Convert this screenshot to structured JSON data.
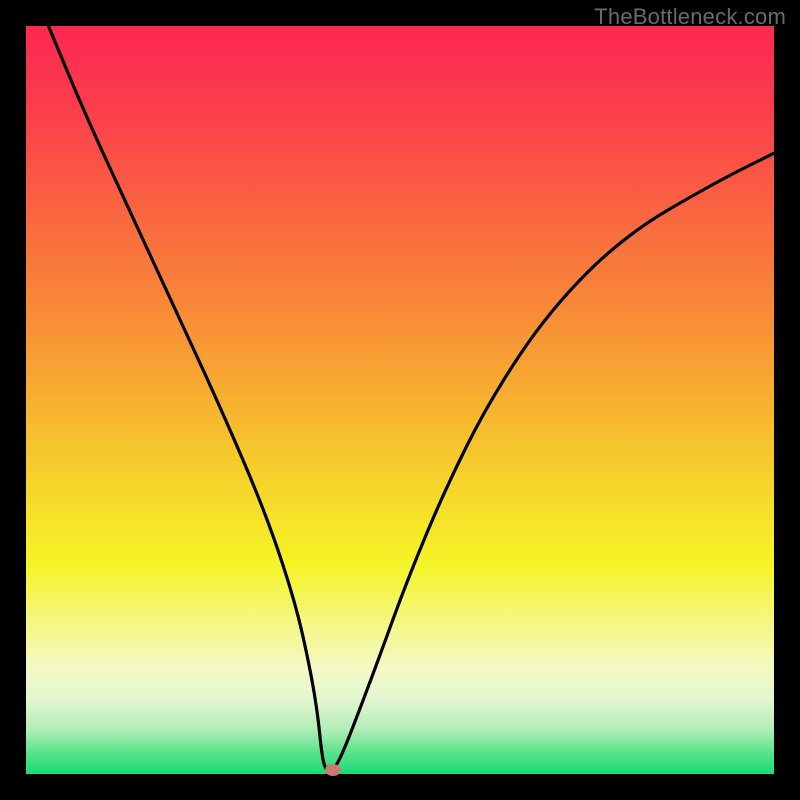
{
  "watermark": "TheBottleneck.com",
  "chart_data": {
    "type": "line",
    "title": "",
    "xlabel": "",
    "ylabel": "",
    "xlim": [
      0,
      100
    ],
    "ylim": [
      0,
      100
    ],
    "grid": false,
    "legend": false,
    "background": "gradient-red-to-green",
    "series": [
      {
        "name": "bottleneck-curve",
        "x": [
          3,
          8,
          14,
          20,
          26,
          32,
          36,
          38,
          39,
          39.5,
          40,
          41,
          42,
          44,
          47,
          51,
          56,
          62,
          70,
          80,
          92,
          100
        ],
        "values": [
          100,
          88,
          75,
          62,
          49,
          35,
          23,
          14,
          8,
          3,
          0.5,
          0.5,
          2,
          7,
          15,
          26,
          38,
          50,
          62,
          72,
          79,
          83
        ]
      }
    ],
    "marker": {
      "x": 41,
      "y": 0.5,
      "color": "#cb7a72"
    }
  },
  "colors": {
    "frame": "#000000",
    "curve": "#000000",
    "watermark_text": "#6a6a6a"
  }
}
